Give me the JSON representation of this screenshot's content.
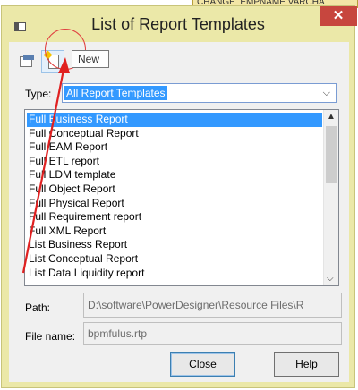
{
  "background": {
    "header_text": "CHANGE_EMPNAME  VARCHA"
  },
  "dialog": {
    "title": "List of Report Templates",
    "close_glyph": "✕"
  },
  "toolbar": {
    "properties_icon": "properties-icon",
    "new_icon": "new-document-icon",
    "folder_icon": "folder-icon",
    "tooltip": "New"
  },
  "type": {
    "label": "Type:",
    "value": "All Report Templates",
    "arrow": "⌵"
  },
  "templates": {
    "items": [
      "Full Business Report",
      "Full Conceptual Report",
      "Full EAM Report",
      "Full ETL report",
      "Full LDM template",
      "Full Object Report",
      "Full Physical Report",
      "Full Requirement report",
      "Full XML Report",
      "List Business Report",
      "List Conceptual Report",
      "List Data Liquidity report"
    ],
    "selected_index": 0
  },
  "scrollbar": {
    "up": "▲",
    "down": "⌵"
  },
  "path": {
    "label": "Path:",
    "value": "D:\\software\\PowerDesigner\\Resource Files\\R"
  },
  "file": {
    "label": "File name:",
    "value": "bpmfulus.rtp"
  },
  "buttons": {
    "close": "Close",
    "help": "Help"
  },
  "annotation": {
    "color": "#e02020"
  }
}
